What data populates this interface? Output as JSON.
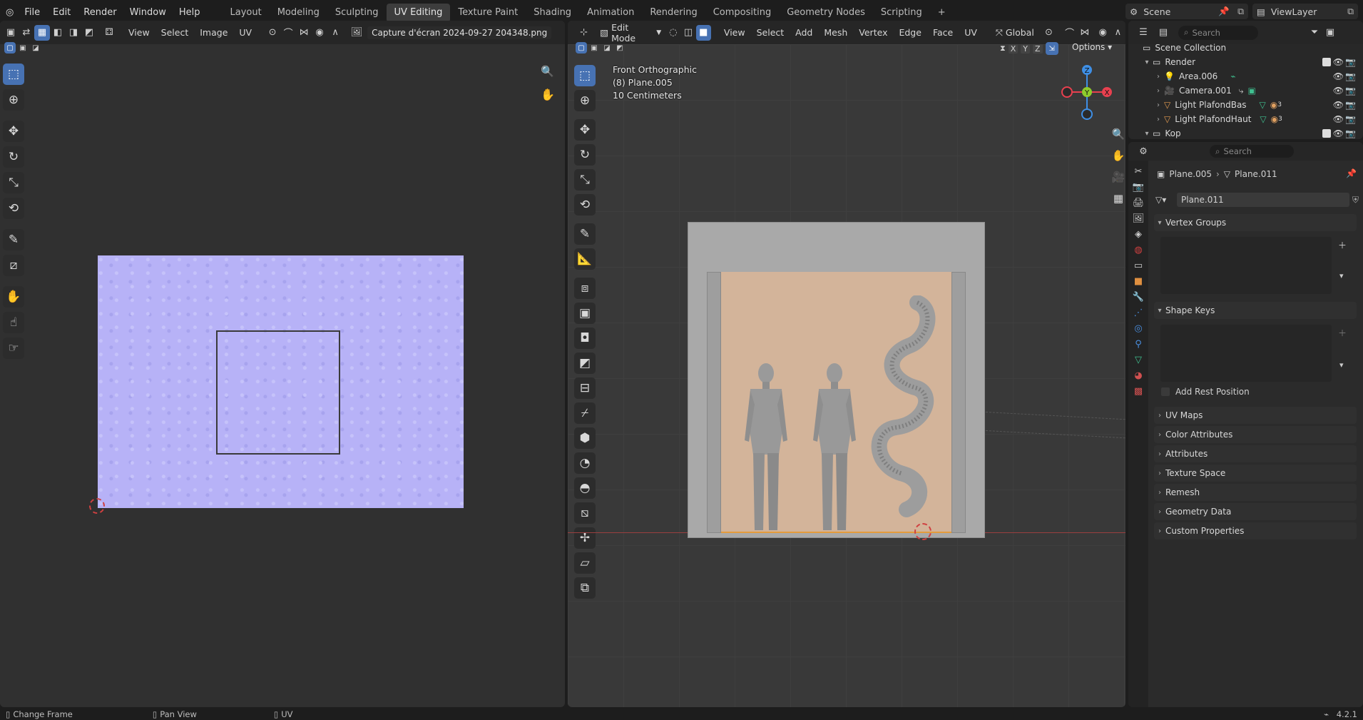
{
  "topbar": {
    "menus": [
      "File",
      "Edit",
      "Render",
      "Window",
      "Help"
    ],
    "workspaces": [
      "Layout",
      "Modeling",
      "Sculpting",
      "UV Editing",
      "Texture Paint",
      "Shading",
      "Animation",
      "Rendering",
      "Compositing",
      "Geometry Nodes",
      "Scripting"
    ],
    "active_workspace": "UV Editing",
    "add_workspace": "+",
    "scene": "Scene",
    "view_layer": "ViewLayer"
  },
  "uv_editor": {
    "menus": [
      "View",
      "Select",
      "Image",
      "UV"
    ],
    "image_name": "Capture d'écran 2024-09-27 204348.png",
    "texture_color": "#b7b2f7"
  },
  "viewport": {
    "mode": "Edit Mode",
    "menus": [
      "View",
      "Select",
      "Add",
      "Mesh",
      "Vertex",
      "Edge",
      "Face",
      "UV"
    ],
    "orientation": "Global",
    "options": "Options",
    "overlay_view": "Front Orthographic",
    "overlay_object": "(8) Plane.005",
    "overlay_scale": "10 Centimeters",
    "gizmo": {
      "z": "Z",
      "y": "Y",
      "x": "X"
    },
    "axis_colors": {
      "x": "#e8404f",
      "y": "#8ecb2c",
      "z": "#3f8fe5"
    },
    "wall_color": "#d3b49a",
    "frame_color": "#a9a9a9"
  },
  "outliner": {
    "search_placeholder": "Search",
    "rows": [
      {
        "label": "Scene Collection",
        "icon": "collection-icon",
        "level": 0
      },
      {
        "label": "Render",
        "icon": "collection-icon",
        "level": 1
      },
      {
        "label": "Area.006",
        "icon": "light-icon",
        "level": 2
      },
      {
        "label": "Camera.001",
        "icon": "camera-icon",
        "level": 2
      },
      {
        "label": "Light PlafondBas",
        "icon": "mesh-icon",
        "level": 2
      },
      {
        "label": "Light PlafondHaut",
        "icon": "mesh-icon",
        "level": 2
      },
      {
        "label": "Kop",
        "icon": "collection-icon",
        "level": 1
      }
    ],
    "badge_count": "3"
  },
  "properties": {
    "search_placeholder": "Search",
    "breadcrumb_object": "Plane.005",
    "breadcrumb_data": "Plane.011",
    "datablock_name": "Plane.011",
    "panels": [
      "Vertex Groups",
      "Shape Keys",
      "UV Maps",
      "Color Attributes",
      "Attributes",
      "Texture Space",
      "Remesh",
      "Geometry Data",
      "Custom Properties"
    ],
    "add_rest_position": "Add Rest Position"
  },
  "statusbar": {
    "left": "Change Frame",
    "middle": "Pan View",
    "right": "UV",
    "version": "4.2.1"
  }
}
